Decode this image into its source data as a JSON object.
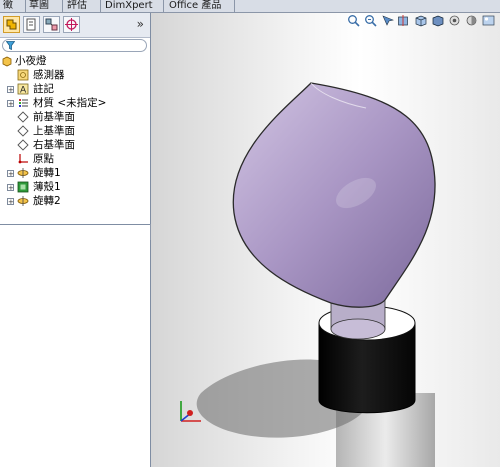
{
  "tabs": [
    {
      "label": "徵",
      "active": false
    },
    {
      "label": "草圖",
      "active": false
    },
    {
      "label": "評估",
      "active": false
    },
    {
      "label": "DimXpert",
      "active": false
    },
    {
      "label": "Office 產品",
      "active": false
    }
  ],
  "panel": {
    "collapse_glyph": "»",
    "tools": [
      "feature-manager-icon",
      "property-manager-icon",
      "configuration-manager-icon",
      "dimxpert-manager-icon"
    ]
  },
  "tree": {
    "root": "小夜燈",
    "items": [
      {
        "label": "感測器",
        "icon": "sensor-icon",
        "expandable": false
      },
      {
        "label": "註記",
        "icon": "annotation-icon",
        "expandable": true
      },
      {
        "label": "材質 <未指定>",
        "icon": "material-icon",
        "expandable": true
      },
      {
        "label": "前基準面",
        "icon": "plane-icon",
        "expandable": false
      },
      {
        "label": "上基準面",
        "icon": "plane-icon",
        "expandable": false
      },
      {
        "label": "右基準面",
        "icon": "plane-icon",
        "expandable": false
      },
      {
        "label": "原點",
        "icon": "origin-icon",
        "expandable": false
      },
      {
        "label": "旋轉1",
        "icon": "revolve-icon",
        "expandable": true
      },
      {
        "label": "薄殼1",
        "icon": "shell-icon",
        "expandable": true
      },
      {
        "label": "旋轉2",
        "icon": "revolve-icon",
        "expandable": true
      }
    ]
  },
  "model": {
    "bulb_color": "#b8a6d0",
    "base_color": "#111111"
  }
}
